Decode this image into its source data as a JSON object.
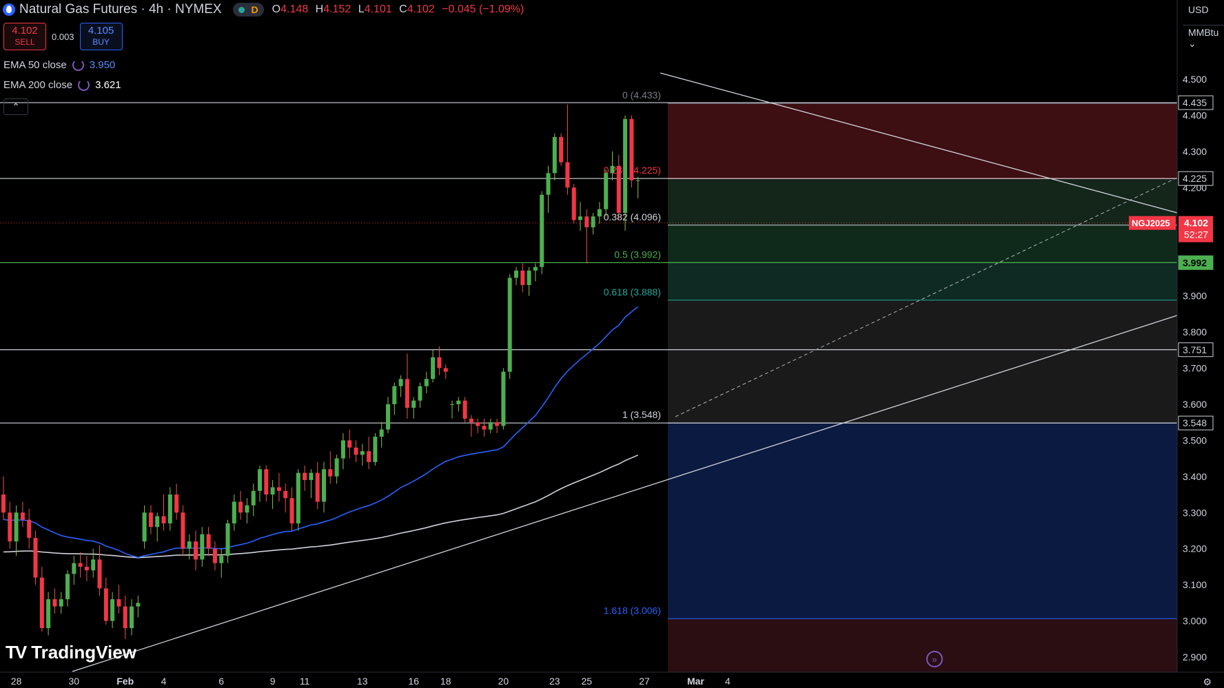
{
  "header": {
    "symbol": "Natural Gas Futures · 4h · NYMEX",
    "market_status_letter": "D",
    "ohlc": {
      "o_label": "O",
      "o": "4.148",
      "h_label": "H",
      "h": "4.152",
      "l_label": "L",
      "l": "4.101",
      "c_label": "C",
      "c": "4.102",
      "change": "−0.045 (−1.09%)"
    }
  },
  "trade": {
    "sell_price": "4.102",
    "sell_label": "SELL",
    "spread": "0.003",
    "buy_price": "4.105",
    "buy_label": "BUY"
  },
  "indicators": [
    {
      "label": "EMA 50 close",
      "value": "3.950",
      "color": "#2962ff"
    },
    {
      "label": "EMA 200 close",
      "value": "3.621",
      "color": "#ffffff"
    }
  ],
  "price_axis": {
    "currency": "USD",
    "unit": "MMBtu"
  },
  "branding": {
    "name": "TradingView"
  },
  "colors": {
    "up": "#4caf50",
    "down": "#f23645",
    "ema50": "#2962ff",
    "ema200": "#d1d4dc",
    "bg": "#000000"
  },
  "chart_data": {
    "type": "candlestick",
    "timeframe": "4h",
    "ylim": [
      2.88,
      4.56
    ],
    "y_ticks": [
      "2.900",
      "3.000",
      "3.100",
      "3.200",
      "3.300",
      "3.400",
      "3.500",
      "3.600",
      "3.700",
      "3.800",
      "3.900",
      "4.000",
      "4.100",
      "4.200",
      "4.300",
      "4.400",
      "4.500"
    ],
    "x_ticks": [
      {
        "label": "28",
        "bar": 2
      },
      {
        "label": "30",
        "bar": 11
      },
      {
        "label": "Feb",
        "bar": 19
      },
      {
        "label": "4",
        "bar": 25
      },
      {
        "label": "6",
        "bar": 34
      },
      {
        "label": "9",
        "bar": 42
      },
      {
        "label": "11",
        "bar": 47
      },
      {
        "label": "13",
        "bar": 56
      },
      {
        "label": "16",
        "bar": 64
      },
      {
        "label": "18",
        "bar": 69
      },
      {
        "label": "20",
        "bar": 78
      },
      {
        "label": "23",
        "bar": 86
      },
      {
        "label": "25",
        "bar": 91
      },
      {
        "label": "27",
        "bar": 100
      },
      {
        "label": "Mar",
        "bar": 108
      },
      {
        "label": "4",
        "bar": 113
      }
    ],
    "candles": [
      [
        3.35,
        3.4,
        3.28,
        3.3
      ],
      [
        3.3,
        3.33,
        3.2,
        3.22
      ],
      [
        3.22,
        3.32,
        3.18,
        3.3
      ],
      [
        3.3,
        3.33,
        3.26,
        3.28
      ],
      [
        3.28,
        3.31,
        3.2,
        3.23
      ],
      [
        3.23,
        3.25,
        3.1,
        3.12
      ],
      [
        3.12,
        3.15,
        2.97,
        2.98
      ],
      [
        2.98,
        3.08,
        2.96,
        3.06
      ],
      [
        3.06,
        3.09,
        3.02,
        3.04
      ],
      [
        3.04,
        3.08,
        3.02,
        3.06
      ],
      [
        3.06,
        3.14,
        3.04,
        3.13
      ],
      [
        3.13,
        3.18,
        3.1,
        3.16
      ],
      [
        3.16,
        3.19,
        3.12,
        3.15
      ],
      [
        3.15,
        3.18,
        3.11,
        3.14
      ],
      [
        3.14,
        3.2,
        3.12,
        3.17
      ],
      [
        3.17,
        3.21,
        3.07,
        3.09
      ],
      [
        3.09,
        3.12,
        2.99,
        3.0
      ],
      [
        3.0,
        3.08,
        2.98,
        3.06
      ],
      [
        3.06,
        3.1,
        3.02,
        3.04
      ],
      [
        3.04,
        3.07,
        2.95,
        2.98
      ],
      [
        2.98,
        3.06,
        2.96,
        3.04
      ],
      [
        3.04,
        3.07,
        3.01,
        3.05
      ],
      [
        3.22,
        3.32,
        3.2,
        3.3
      ],
      [
        3.3,
        3.32,
        3.24,
        3.26
      ],
      [
        3.26,
        3.3,
        3.22,
        3.29
      ],
      [
        3.29,
        3.35,
        3.25,
        3.27
      ],
      [
        3.27,
        3.37,
        3.25,
        3.35
      ],
      [
        3.35,
        3.38,
        3.28,
        3.3
      ],
      [
        3.3,
        3.32,
        3.18,
        3.2
      ],
      [
        3.2,
        3.24,
        3.17,
        3.22
      ],
      [
        3.22,
        3.25,
        3.14,
        3.17
      ],
      [
        3.17,
        3.26,
        3.15,
        3.24
      ],
      [
        3.24,
        3.26,
        3.18,
        3.2
      ],
      [
        3.2,
        3.22,
        3.14,
        3.16
      ],
      [
        3.16,
        3.2,
        3.12,
        3.18
      ],
      [
        3.18,
        3.28,
        3.16,
        3.27
      ],
      [
        3.27,
        3.35,
        3.25,
        3.33
      ],
      [
        3.33,
        3.36,
        3.28,
        3.3
      ],
      [
        3.3,
        3.34,
        3.27,
        3.32
      ],
      [
        3.32,
        3.38,
        3.29,
        3.36
      ],
      [
        3.36,
        3.43,
        3.33,
        3.42
      ],
      [
        3.42,
        3.43,
        3.33,
        3.35
      ],
      [
        3.35,
        3.39,
        3.31,
        3.37
      ],
      [
        3.37,
        3.41,
        3.33,
        3.36
      ],
      [
        3.36,
        3.38,
        3.3,
        3.34
      ],
      [
        3.34,
        3.37,
        3.25,
        3.27
      ],
      [
        3.27,
        3.42,
        3.25,
        3.41
      ],
      [
        3.41,
        3.43,
        3.36,
        3.39
      ],
      [
        3.39,
        3.42,
        3.34,
        3.41
      ],
      [
        3.41,
        3.44,
        3.31,
        3.33
      ],
      [
        3.33,
        3.44,
        3.3,
        3.42
      ],
      [
        3.42,
        3.47,
        3.38,
        3.4
      ],
      [
        3.4,
        3.46,
        3.38,
        3.45
      ],
      [
        3.45,
        3.52,
        3.42,
        3.5
      ],
      [
        3.5,
        3.53,
        3.45,
        3.48
      ],
      [
        3.48,
        3.5,
        3.44,
        3.46
      ],
      [
        3.46,
        3.49,
        3.43,
        3.47
      ],
      [
        3.47,
        3.51,
        3.42,
        3.44
      ],
      [
        3.44,
        3.52,
        3.43,
        3.51
      ],
      [
        3.51,
        3.55,
        3.48,
        3.53
      ],
      [
        3.53,
        3.62,
        3.52,
        3.6
      ],
      [
        3.6,
        3.66,
        3.57,
        3.65
      ],
      [
        3.65,
        3.68,
        3.62,
        3.67
      ],
      [
        3.67,
        3.74,
        3.56,
        3.59
      ],
      [
        3.59,
        3.62,
        3.56,
        3.61
      ],
      [
        3.61,
        3.66,
        3.59,
        3.65
      ],
      [
        3.65,
        3.69,
        3.63,
        3.67
      ],
      [
        3.67,
        3.75,
        3.66,
        3.73
      ],
      [
        3.73,
        3.76,
        3.68,
        3.7
      ],
      [
        3.7,
        3.71,
        3.67,
        3.69
      ],
      [
        3.6,
        3.61,
        3.56,
        3.6
      ],
      [
        3.6,
        3.62,
        3.58,
        3.61
      ],
      [
        3.61,
        3.62,
        3.55,
        3.56
      ],
      [
        3.56,
        3.57,
        3.51,
        3.55
      ],
      [
        3.55,
        3.56,
        3.52,
        3.54
      ],
      [
        3.54,
        3.56,
        3.51,
        3.53
      ],
      [
        3.53,
        3.56,
        3.52,
        3.55
      ],
      [
        3.55,
        3.56,
        3.52,
        3.54
      ],
      [
        3.54,
        3.7,
        3.53,
        3.69
      ],
      [
        3.69,
        3.96,
        3.67,
        3.95
      ],
      [
        3.95,
        3.98,
        3.93,
        3.97
      ],
      [
        3.97,
        3.99,
        3.91,
        3.93
      ],
      [
        3.93,
        3.98,
        3.9,
        3.97
      ],
      [
        3.97,
        3.99,
        3.94,
        3.98
      ],
      [
        3.98,
        4.19,
        3.96,
        4.18
      ],
      [
        4.18,
        4.26,
        4.13,
        4.24
      ],
      [
        4.24,
        4.35,
        4.22,
        4.34
      ],
      [
        4.34,
        4.35,
        4.26,
        4.27
      ],
      [
        4.27,
        4.43,
        4.18,
        4.2
      ],
      [
        4.2,
        4.21,
        4.1,
        4.11
      ],
      [
        4.11,
        4.16,
        4.08,
        4.12
      ],
      [
        4.12,
        4.14,
        3.99,
        4.09
      ],
      [
        4.09,
        4.13,
        4.07,
        4.12
      ],
      [
        4.12,
        4.16,
        4.1,
        4.14
      ],
      [
        4.14,
        4.25,
        4.12,
        4.24
      ],
      [
        4.24,
        4.3,
        4.22,
        4.26
      ],
      [
        4.26,
        4.29,
        4.11,
        4.13
      ],
      [
        4.13,
        4.4,
        4.08,
        4.39
      ],
      [
        4.39,
        4.4,
        4.2,
        4.22
      ],
      [
        4.22,
        4.23,
        4.17,
        4.22
      ]
    ],
    "ema50_anchor": "3.950",
    "ema200_anchor": "3.621",
    "fibonacci": [
      {
        "level": "0",
        "price": 4.433,
        "label": "0 (4.433)",
        "color": "#787b86"
      },
      {
        "level": "0.236",
        "price": 4.225,
        "label": "0.236 (4.225)",
        "color": "#f23645"
      },
      {
        "level": "0.382",
        "price": 4.096,
        "label": "0.382 (4.096)",
        "color": "#d1d4dc"
      },
      {
        "level": "0.5",
        "price": 3.992,
        "label": "0.5 (3.992)",
        "color": "#4caf50"
      },
      {
        "level": "0.618",
        "price": 3.888,
        "label": "0.618 (3.888)",
        "color": "#26a69a"
      },
      {
        "level": "1",
        "price": 3.548,
        "label": "1 (3.548)",
        "color": "#d1d4dc"
      },
      {
        "level": "1.618",
        "price": 3.006,
        "label": "1.618 (3.006)",
        "color": "#2962ff"
      }
    ],
    "horizontal_levels": [
      {
        "price": 4.435,
        "label": "4.435"
      },
      {
        "price": 4.225,
        "label": "4.225"
      },
      {
        "price": 3.992,
        "label": "3.992",
        "highlight": true
      },
      {
        "price": 3.751,
        "label": "3.751"
      },
      {
        "price": 3.548,
        "label": "3.548"
      }
    ],
    "last_price": {
      "symbol": "NGJ2025",
      "price": "4.102",
      "countdown": "52:27"
    }
  }
}
